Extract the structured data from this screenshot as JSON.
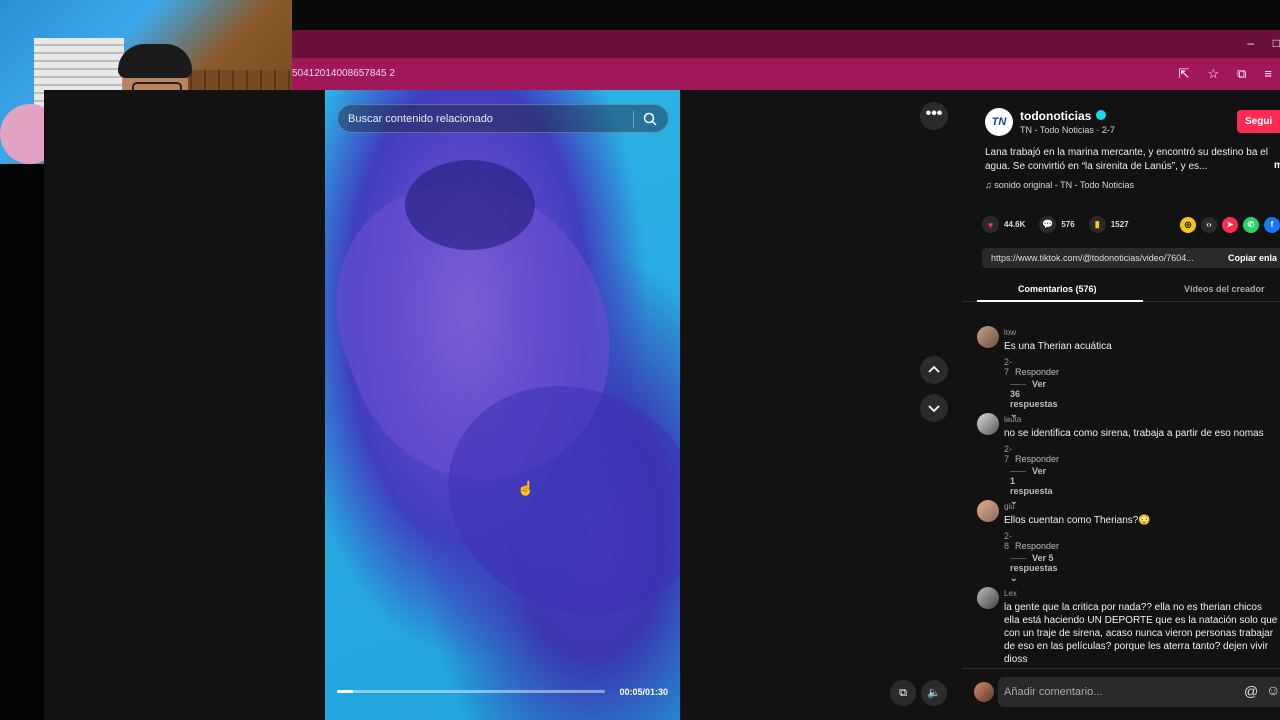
{
  "browser": {
    "url_fragment": "50412014008657845 2",
    "min_icon": "–",
    "max_icon": "□"
  },
  "search": {
    "placeholder": "Buscar contenido relacionado"
  },
  "player": {
    "time": "00:05/01:30",
    "progress_fraction": 0.06
  },
  "author": {
    "logo_text": "TN",
    "name": "todonoticias",
    "sub": "TN - Todo Noticias · 2-7",
    "follow_label": "Segui"
  },
  "description": {
    "text": "Lana trabajó en la marina mercante, y encontró su destino ba el agua. Se convirtió en “la sirenita de Lanús”, y es...",
    "more": "m"
  },
  "sound": "sonido original - TN - Todo Noticias",
  "actions": {
    "likes": "44.6K",
    "comments": "576",
    "saves": "1527"
  },
  "link": {
    "url": "https://www.tiktok.com/@todonoticias/video/7604...",
    "copy_label": "Copiar enla"
  },
  "tabs": {
    "comments": "Comentarios (576)",
    "creator_videos": "Vídeos del creador"
  },
  "comments": [
    {
      "user": "low",
      "text": "Es una Therian acuática",
      "date": "2-7",
      "reply": "Responder",
      "more": "Ver 36 respuestas ⌄"
    },
    {
      "user": "lauta",
      "text": "no se identifica como sirena, trabaja a partir de eso nomas",
      "date": "2-7",
      "reply": "Responder",
      "more": "Ver 1 respuesta ⌄"
    },
    {
      "user": "giu",
      "text": "Ellos cuentan como Therians?😳",
      "date": "2-8",
      "reply": "Responder",
      "more": "Ver 5 respuestas ⌄"
    },
    {
      "user": "Lex",
      "text": "la gente que la critica por nada?? ella no es therian chicos ella está haciendo UN DEPORTE que es la natación solo que con un traje de sirena, acaso nunca vieron personas trabajar de eso en las películas? porque les aterra tanto? dejen vivir dioss"
    }
  ],
  "comment_input": {
    "placeholder": "Añadir comentario..."
  },
  "icons": {
    "more": "•••",
    "at": "@",
    "emoji": "☺"
  }
}
